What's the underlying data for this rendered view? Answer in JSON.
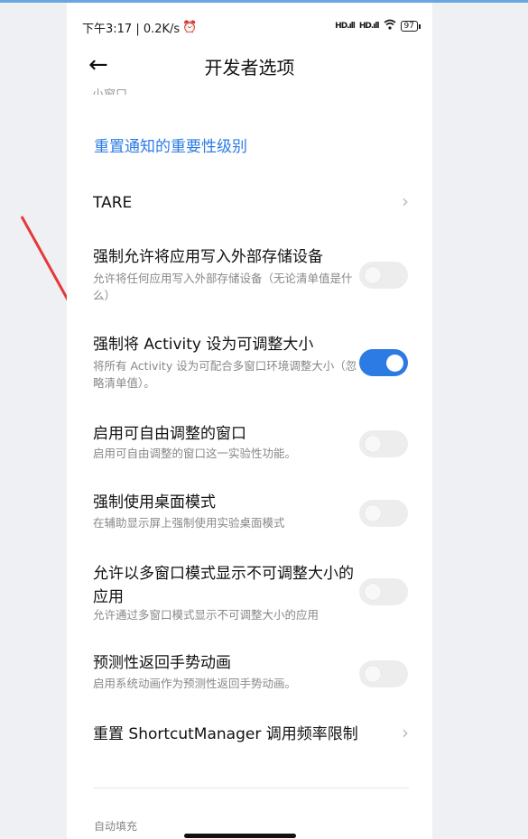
{
  "status": {
    "time_speed": "下午3:17 | 0.2K/s",
    "signal1": "HD.ıll",
    "signal2": "HD.ıll",
    "battery": "97"
  },
  "header": {
    "title": "开发者选项"
  },
  "top_cut_text": "小窗口",
  "reset_link": "重置通知的重要性级别",
  "items": [
    {
      "title": "TARE",
      "desc": ""
    },
    {
      "title": "强制允许将应用写入外部存储设备",
      "desc": "允许将任何应用写入外部存储设备（无论清单值是什么）",
      "enabled": false
    },
    {
      "title": "强制将 Activity 设为可调整大小",
      "desc": "将所有 Activity 设为可配合多窗口环境调整大小（忽略清单值）。",
      "enabled": true
    },
    {
      "title": "启用可自由调整的窗口",
      "desc": "启用可自由调整的窗口这一实验性功能。",
      "enabled": false
    },
    {
      "title": "强制使用桌面模式",
      "desc": "在辅助显示屏上强制使用实验桌面模式",
      "enabled": false
    },
    {
      "title": "允许以多窗口模式显示不可调整大小的应用",
      "desc": "允许通过多窗口模式显示不可调整大小的应用",
      "enabled": false
    },
    {
      "title": "预测性返回手势动画",
      "desc": "启用系统动画作为预测性返回手势动画。",
      "enabled": false
    },
    {
      "title": "重置 ShortcutManager 调用频率限制",
      "desc": ""
    }
  ],
  "section_autofill": "自动填充",
  "colors": {
    "accent": "#2c7be5",
    "annotation_arrow": "#e53935"
  }
}
